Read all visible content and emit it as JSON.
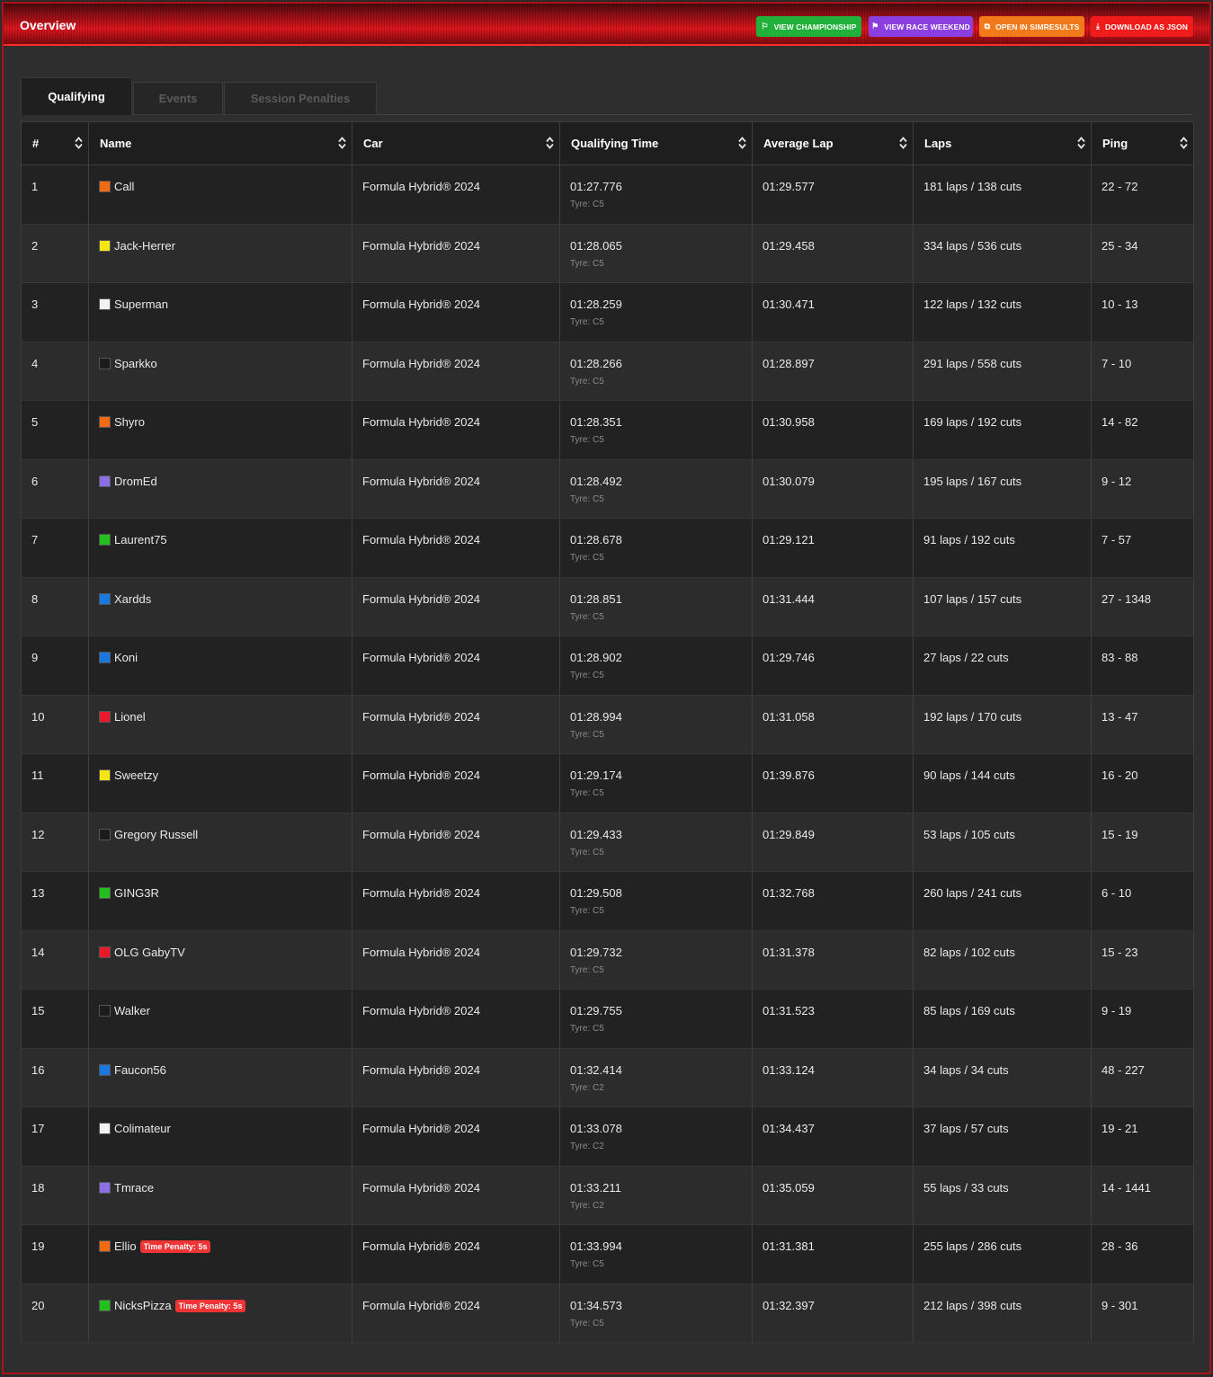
{
  "header": {
    "title": "Overview",
    "buttons": [
      {
        "label": "VIEW CHAMPIONSHIP",
        "icon": "flag-icon",
        "color": "#21b13a"
      },
      {
        "label": "VIEW RACE WEEKEND",
        "icon": "flags-icon",
        "color": "#8b3fe0"
      },
      {
        "label": "OPEN IN SIMRESULTS",
        "icon": "external-link-icon",
        "color": "#f27a1a"
      },
      {
        "label": "DOWNLOAD AS JSON",
        "icon": "download-icon",
        "color": "#f01b1b"
      }
    ]
  },
  "tabs": [
    "Qualifying",
    "Events",
    "Session Penalties"
  ],
  "columns": [
    "#",
    "Name",
    "Car",
    "Qualifying Time",
    "Average Lap",
    "Laps",
    "Ping"
  ],
  "rows": [
    {
      "pos": "1",
      "name": "Call",
      "color": "#f26a12",
      "car": "Formula Hybrid® 2024",
      "qtime": "01:27.776",
      "tyre": "Tyre: C5",
      "avg": "01:29.577",
      "laps": "181 laps / 138 cuts",
      "ping": "22 - 72",
      "penalty": ""
    },
    {
      "pos": "2",
      "name": "Jack-Herrer",
      "color": "#f5e613",
      "car": "Formula Hybrid® 2024",
      "qtime": "01:28.065",
      "tyre": "Tyre: C5",
      "avg": "01:29.458",
      "laps": "334 laps / 536 cuts",
      "ping": "25 - 34",
      "penalty": ""
    },
    {
      "pos": "3",
      "name": "Superman",
      "color": "#f2f2f2",
      "car": "Formula Hybrid® 2024",
      "qtime": "01:28.259",
      "tyre": "Tyre: C5",
      "avg": "01:30.471",
      "laps": "122 laps / 132 cuts",
      "ping": "10 - 13",
      "penalty": ""
    },
    {
      "pos": "4",
      "name": "Sparkko",
      "color": "#1c1c1c",
      "car": "Formula Hybrid® 2024",
      "qtime": "01:28.266",
      "tyre": "Tyre: C5",
      "avg": "01:28.897",
      "laps": "291 laps / 558 cuts",
      "ping": "7 - 10",
      "penalty": ""
    },
    {
      "pos": "5",
      "name": "Shyro",
      "color": "#f26a12",
      "car": "Formula Hybrid® 2024",
      "qtime": "01:28.351",
      "tyre": "Tyre: C5",
      "avg": "01:30.958",
      "laps": "169 laps / 192 cuts",
      "ping": "14 - 82",
      "penalty": ""
    },
    {
      "pos": "6",
      "name": "DromEd",
      "color": "#8c6ee6",
      "car": "Formula Hybrid® 2024",
      "qtime": "01:28.492",
      "tyre": "Tyre: C5",
      "avg": "01:30.079",
      "laps": "195 laps / 167 cuts",
      "ping": "9 - 12",
      "penalty": ""
    },
    {
      "pos": "7",
      "name": "Laurent75",
      "color": "#22c01c",
      "car": "Formula Hybrid® 2024",
      "qtime": "01:28.678",
      "tyre": "Tyre: C5",
      "avg": "01:29.121",
      "laps": "91 laps / 192 cuts",
      "ping": "7 - 57",
      "penalty": ""
    },
    {
      "pos": "8",
      "name": "Xardds",
      "color": "#1a78e0",
      "car": "Formula Hybrid® 2024",
      "qtime": "01:28.851",
      "tyre": "Tyre: C5",
      "avg": "01:31.444",
      "laps": "107 laps / 157 cuts",
      "ping": "27 - 1348",
      "penalty": ""
    },
    {
      "pos": "9",
      "name": "Koni",
      "color": "#1a78e0",
      "car": "Formula Hybrid® 2024",
      "qtime": "01:28.902",
      "tyre": "Tyre: C5",
      "avg": "01:29.746",
      "laps": "27 laps / 22 cuts",
      "ping": "83 - 88",
      "penalty": ""
    },
    {
      "pos": "10",
      "name": "Lionel",
      "color": "#e81a2a",
      "car": "Formula Hybrid® 2024",
      "qtime": "01:28.994",
      "tyre": "Tyre: C5",
      "avg": "01:31.058",
      "laps": "192 laps / 170 cuts",
      "ping": "13 - 47",
      "penalty": ""
    },
    {
      "pos": "11",
      "name": "Sweetzy",
      "color": "#f5e613",
      "car": "Formula Hybrid® 2024",
      "qtime": "01:29.174",
      "tyre": "Tyre: C5",
      "avg": "01:39.876",
      "laps": "90 laps / 144 cuts",
      "ping": "16 - 20",
      "penalty": ""
    },
    {
      "pos": "12",
      "name": "Gregory Russell",
      "color": "#1c1c1c",
      "car": "Formula Hybrid® 2024",
      "qtime": "01:29.433",
      "tyre": "Tyre: C5",
      "avg": "01:29.849",
      "laps": "53 laps / 105 cuts",
      "ping": "15 - 19",
      "penalty": ""
    },
    {
      "pos": "13",
      "name": "GING3R",
      "color": "#22c01c",
      "car": "Formula Hybrid® 2024",
      "qtime": "01:29.508",
      "tyre": "Tyre: C5",
      "avg": "01:32.768",
      "laps": "260 laps / 241 cuts",
      "ping": "6 - 10",
      "penalty": ""
    },
    {
      "pos": "14",
      "name": "OLG GabyTV",
      "color": "#e81a2a",
      "car": "Formula Hybrid® 2024",
      "qtime": "01:29.732",
      "tyre": "Tyre: C5",
      "avg": "01:31.378",
      "laps": "82 laps / 102 cuts",
      "ping": "15 - 23",
      "penalty": ""
    },
    {
      "pos": "15",
      "name": "Walker",
      "color": "#1c1c1c",
      "car": "Formula Hybrid® 2024",
      "qtime": "01:29.755",
      "tyre": "Tyre: C5",
      "avg": "01:31.523",
      "laps": "85 laps / 169 cuts",
      "ping": "9 - 19",
      "penalty": ""
    },
    {
      "pos": "16",
      "name": "Faucon56",
      "color": "#1a78e0",
      "car": "Formula Hybrid® 2024",
      "qtime": "01:32.414",
      "tyre": "Tyre: C2",
      "avg": "01:33.124",
      "laps": "34 laps / 34 cuts",
      "ping": "48 - 227",
      "penalty": ""
    },
    {
      "pos": "17",
      "name": "Colimateur",
      "color": "#f2f2f2",
      "car": "Formula Hybrid® 2024",
      "qtime": "01:33.078",
      "tyre": "Tyre: C2",
      "avg": "01:34.437",
      "laps": "37 laps / 57 cuts",
      "ping": "19 - 21",
      "penalty": ""
    },
    {
      "pos": "18",
      "name": "Tmrace",
      "color": "#8c6ee6",
      "car": "Formula Hybrid® 2024",
      "qtime": "01:33.211",
      "tyre": "Tyre: C2",
      "avg": "01:35.059",
      "laps": "55 laps / 33 cuts",
      "ping": "14 - 1441",
      "penalty": ""
    },
    {
      "pos": "19",
      "name": "Ellio",
      "color": "#f26a12",
      "car": "Formula Hybrid® 2024",
      "qtime": "01:33.994",
      "tyre": "Tyre: C5",
      "avg": "01:31.381",
      "laps": "255 laps / 286 cuts",
      "ping": "28 - 36",
      "penalty": "Time Penalty: 5s"
    },
    {
      "pos": "20",
      "name": "NicksPizza",
      "color": "#22c01c",
      "car": "Formula Hybrid® 2024",
      "qtime": "01:34.573",
      "tyre": "Tyre: C5",
      "avg": "01:32.397",
      "laps": "212 laps / 398 cuts",
      "ping": "9 - 301",
      "penalty": "Time Penalty: 5s"
    }
  ]
}
